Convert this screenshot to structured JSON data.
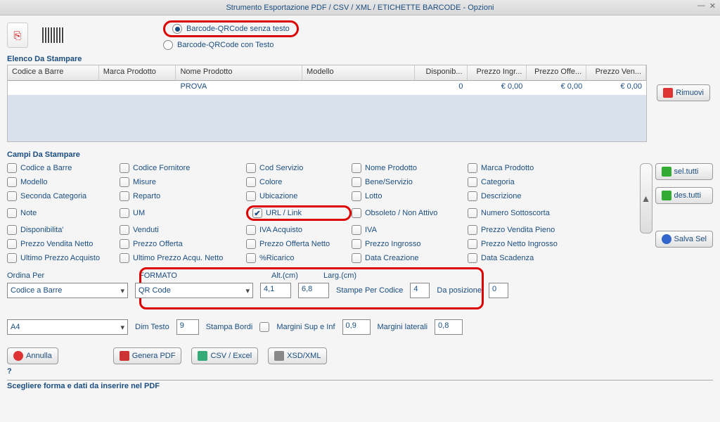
{
  "window": {
    "title": "Strumento Esportazione PDF / CSV / XML / ETICHETTE BARCODE - Opzioni"
  },
  "radio": {
    "opt1": "Barcode-QRCode senza testo",
    "opt2": "Barcode-QRCode con Testo"
  },
  "list": {
    "header": "Elenco Da Stampare",
    "cols": {
      "c1": "Codice a Barre",
      "c2": "Marca Prodotto",
      "c3": "Nome Prodotto",
      "c4": "Modello",
      "c5": "Disponib...",
      "c6": "Prezzo Ingr...",
      "c7": "Prezzo Offe...",
      "c8": "Prezzo Ven..."
    },
    "row": {
      "c1": "",
      "c2": "",
      "c3": "PROVA",
      "c4": "",
      "c5": "0",
      "c6": "€ 0,00",
      "c7": "€ 0,00",
      "c8": "€ 0,00"
    },
    "remove": "Rimuovi"
  },
  "fields": {
    "header": "Campi Da Stampare",
    "seltutti": "sel.tutti",
    "destutti": "des.tutti",
    "salvasel": "Salva Sel",
    "items": {
      "r1": {
        "a": "Codice a Barre",
        "b": "Codice Fornitore",
        "c": "Cod Servizio",
        "d": "Nome Prodotto",
        "e": "Marca Prodotto"
      },
      "r2": {
        "a": "Modello",
        "b": "Misure",
        "c": "Colore",
        "d": "Bene/Servizio",
        "e": "Categoria"
      },
      "r3": {
        "a": "Seconda Categoria",
        "b": "Reparto",
        "c": "Ubicazione",
        "d": "Lotto",
        "e": "Descrizione"
      },
      "r4": {
        "a": "Note",
        "b": "UM",
        "c": "URL / Link",
        "d": "Obsoleto / Non Attivo",
        "e": "Numero Sottoscorta"
      },
      "r5": {
        "a": "Disponibilita'",
        "b": "Venduti",
        "c": "IVA Acquisto",
        "d": "IVA",
        "e": "Prezzo Vendita Pieno"
      },
      "r6": {
        "a": "Prezzo Vendita Netto",
        "b": "Prezzo Offerta",
        "c": "Prezzo Offerta Netto",
        "d": "Prezzo Ingrosso",
        "e": "Prezzo Netto Ingrosso"
      },
      "r7": {
        "a": "Ultimo Prezzo Acquisto",
        "b": "Ultimo Prezzo Acqu. Netto",
        "c": "%Ricarico",
        "d": "Data Creazione",
        "e": "Data Scadenza"
      }
    }
  },
  "controls": {
    "ordina_lbl": "Ordina Per",
    "ordina_val": "Codice a Barre",
    "formato_lbl": "FORMATO",
    "formato_val": "QR Code",
    "alt_lbl": "Alt.(cm)",
    "alt_val": "4,1",
    "larg_lbl": "Larg.(cm)",
    "larg_val": "6,8",
    "stampe_lbl": "Stampe Per Codice",
    "stampe_val": "4",
    "dapos_lbl": "Da posizione",
    "dapos_val": "0",
    "carta_val": "A4",
    "dimtesto_lbl": "Dim Testo",
    "dimtesto_val": "9",
    "bordi_lbl": "Stampa Bordi",
    "marginitb_lbl": "Margini Sup e Inf",
    "marginitb_val": "0,9",
    "marginilat_lbl": "Margini laterali",
    "marginilat_val": "0,8"
  },
  "actions": {
    "annulla": "Annulla",
    "generapdf": "Genera PDF",
    "csv": "CSV / Excel",
    "xsd": "XSD/XML"
  },
  "hint": {
    "q": "?",
    "text": "Scegliere forma e dati da inserire nel PDF"
  }
}
